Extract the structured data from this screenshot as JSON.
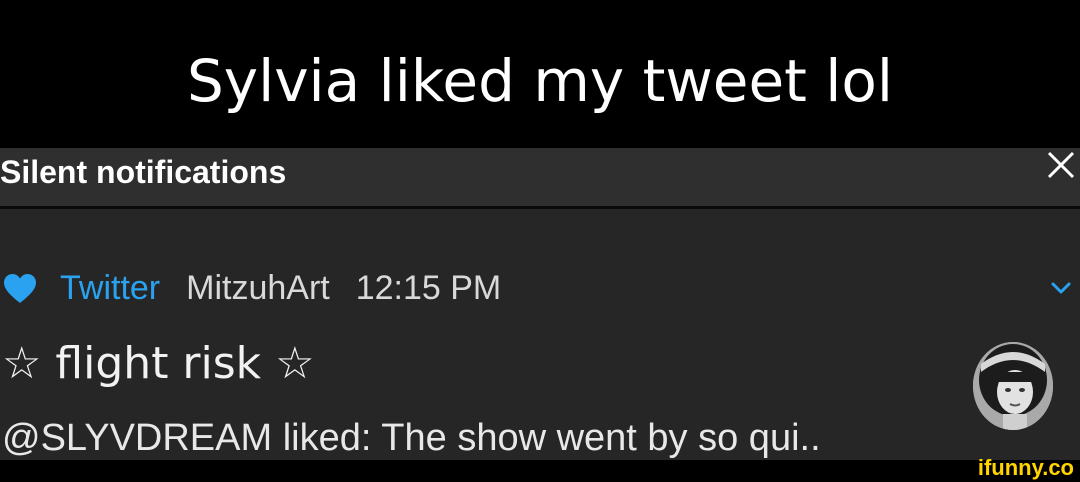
{
  "caption": {
    "text": "Sylvia liked my tweet lol"
  },
  "header": {
    "title": "Silent notifications"
  },
  "notification": {
    "app_name": "Twitter",
    "account": "MitzuhArt",
    "time": "12:15 PM",
    "title": "☆ flight risk ☆",
    "text": "@SLYVDREAM liked: The show went by so qui.."
  },
  "icons": {
    "close": "close-icon",
    "heart": "heart-icon",
    "chevron": "chevron-down-icon",
    "avatar": "avatar"
  },
  "colors": {
    "accent_blue": "#2aa2ef",
    "header_bg": "#2f2f2f",
    "body_bg": "#262626",
    "watermark": "#ffd400"
  },
  "watermark": {
    "text": "ifunny.co"
  }
}
